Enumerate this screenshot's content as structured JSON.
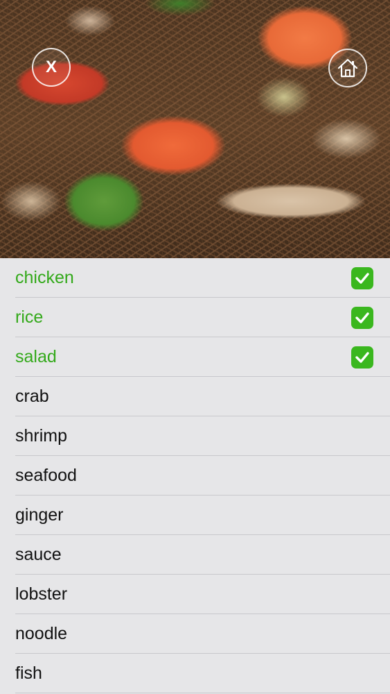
{
  "photo": {
    "close_label": "X",
    "close_icon": "close-icon",
    "home_icon": "home-icon"
  },
  "tags": [
    {
      "label": "chicken",
      "selected": true
    },
    {
      "label": "rice",
      "selected": true
    },
    {
      "label": "salad",
      "selected": true
    },
    {
      "label": "crab",
      "selected": false
    },
    {
      "label": "shrimp",
      "selected": false
    },
    {
      "label": "seafood",
      "selected": false
    },
    {
      "label": "ginger",
      "selected": false
    },
    {
      "label": "sauce",
      "selected": false
    },
    {
      "label": "lobster",
      "selected": false
    },
    {
      "label": "noodle",
      "selected": false
    },
    {
      "label": "fish",
      "selected": false
    }
  ],
  "colors": {
    "selected_text": "#33a91a",
    "checkbox": "#3ab71e",
    "list_background": "#e6e6e8",
    "divider": "#c8c8cc"
  },
  "icons": {
    "checkmark": "check-mark-icon"
  }
}
